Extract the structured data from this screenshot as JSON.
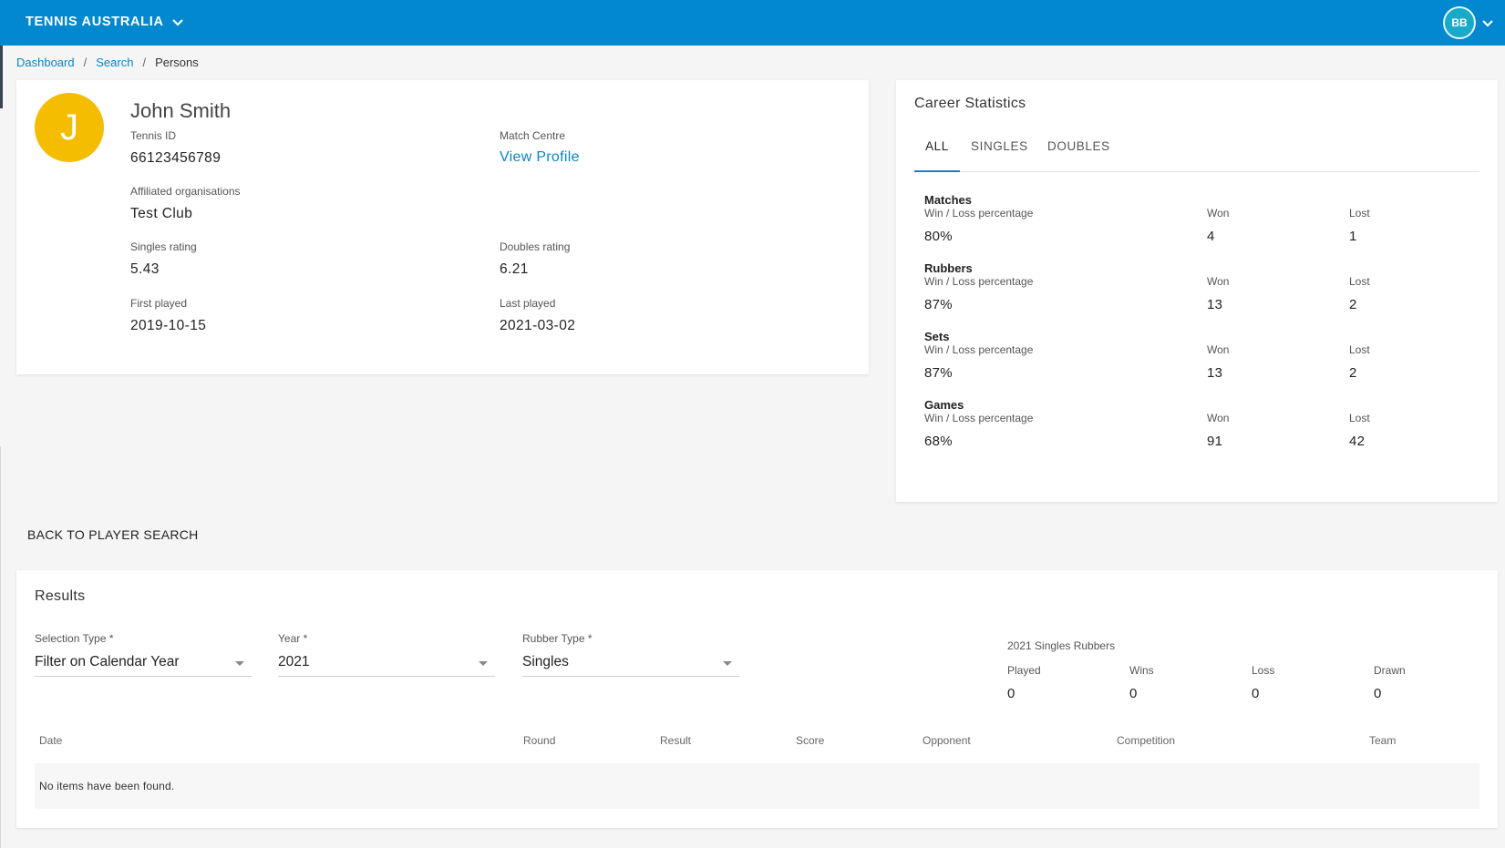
{
  "topbar": {
    "org_name": "TENNIS AUSTRALIA",
    "user_initials": "BB"
  },
  "breadcrumb": {
    "items": [
      "Dashboard",
      "Search"
    ],
    "current": "Persons",
    "separator": "/"
  },
  "profile": {
    "initial": "J",
    "name": "John Smith",
    "tennis_id_label": "Tennis ID",
    "tennis_id": "66123456789",
    "match_centre_label": "Match Centre",
    "match_centre_link": "View Profile",
    "affiliated_label": "Affiliated organisations",
    "affiliated": "Test Club",
    "singles_label": "Singles rating",
    "singles": "5.43",
    "doubles_label": "Doubles rating",
    "doubles": "6.21",
    "first_played_label": "First played",
    "first_played": "2019-10-15",
    "last_played_label": "Last played",
    "last_played": "2021-03-02"
  },
  "career": {
    "title": "Career Statistics",
    "tabs": [
      "ALL",
      "SINGLES",
      "DOUBLES"
    ],
    "active_tab": "ALL",
    "pct_label": "Win / Loss percentage",
    "won_label": "Won",
    "lost_label": "Lost",
    "stats": [
      {
        "name": "Matches",
        "pct": "80%",
        "won": "4",
        "lost": "1"
      },
      {
        "name": "Rubbers",
        "pct": "87%",
        "won": "13",
        "lost": "2"
      },
      {
        "name": "Sets",
        "pct": "87%",
        "won": "13",
        "lost": "2"
      },
      {
        "name": "Games",
        "pct": "68%",
        "won": "91",
        "lost": "42"
      }
    ]
  },
  "back_link": "BACK TO PLAYER SEARCH",
  "results": {
    "title": "Results",
    "selection_type": {
      "label": "Selection Type *",
      "value": "Filter on Calendar Year"
    },
    "year": {
      "label": "Year *",
      "value": "2021"
    },
    "rubber_type": {
      "label": "Rubber Type *",
      "value": "Singles"
    },
    "summary": {
      "title": "2021 Singles Rubbers",
      "played_label": "Played",
      "played": "0",
      "wins_label": "Wins",
      "wins": "0",
      "loss_label": "Loss",
      "loss": "0",
      "drawn_label": "Drawn",
      "drawn": "0"
    },
    "columns": [
      "Date",
      "Round",
      "Result",
      "Score",
      "Opponent",
      "Competition",
      "Team"
    ],
    "empty_message": "No items have been found."
  },
  "colors": {
    "topbar": "#0288cf",
    "link": "#0a84c9",
    "avatar": "#f5bd00",
    "user_avatar": "#19aac9"
  }
}
